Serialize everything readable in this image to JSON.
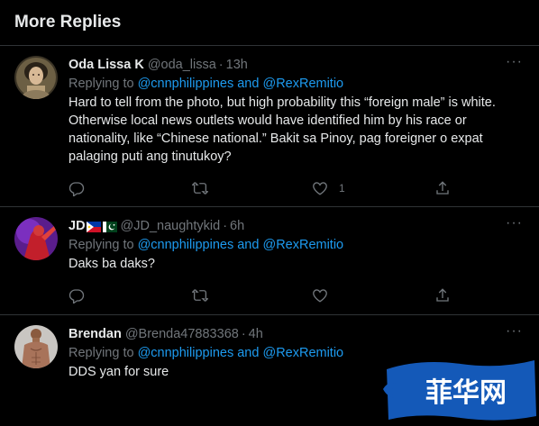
{
  "section": {
    "title": "More Replies"
  },
  "tweets": [
    {
      "name": "Oda Lissa K",
      "handle": "@oda_lissa",
      "separator": "·",
      "time": "13h",
      "replying_prefix": "Replying to",
      "mention1": "@cnnphilippines",
      "and": "and",
      "mention2": "@RexRemitio",
      "lines": [
        "Hard to tell from the photo, but high probability this “foreign male” is white.",
        "Otherwise local news outlets would have identified him by his race or",
        "nationality, like “Chinese national.” Bakit sa Pinoy, pag foreigner o expat",
        "palaging puti ang tinutukoy?"
      ],
      "like_count": "1",
      "more": "···",
      "avatar_icon": "portrait-painting-avatar"
    },
    {
      "name": "JD",
      "handle": "@JD_naughtykid",
      "separator": "·",
      "time": "6h",
      "replying_prefix": "Replying to",
      "mention1": "@cnnphilippines",
      "and": "and",
      "mention2": "@RexRemitio",
      "lines": [
        "Daks ba daks?"
      ],
      "more": "···",
      "flags": [
        "philippines-flag-icon",
        "pakistan-flag-icon"
      ],
      "avatar_icon": "red-figure-avatar"
    },
    {
      "name": "Brendan",
      "handle": "@Brenda47883368",
      "separator": "·",
      "time": "4h",
      "replying_prefix": "Replying to",
      "mention1": "@cnnphilippines",
      "and": "and",
      "mention2": "@RexRemitio",
      "lines": [
        "DDS yan for sure"
      ],
      "more": "···",
      "avatar_icon": "shirtless-man-avatar"
    }
  ],
  "icons": {
    "reply": "reply-icon",
    "retweet": "retweet-icon",
    "like": "heart-icon",
    "share": "share-icon"
  },
  "watermark": {
    "text": "菲华网"
  },
  "colors": {
    "background": "#000000",
    "text": "#e7e9ea",
    "muted": "#71767b",
    "link": "#1d9bf0",
    "divider": "#2f3336"
  }
}
